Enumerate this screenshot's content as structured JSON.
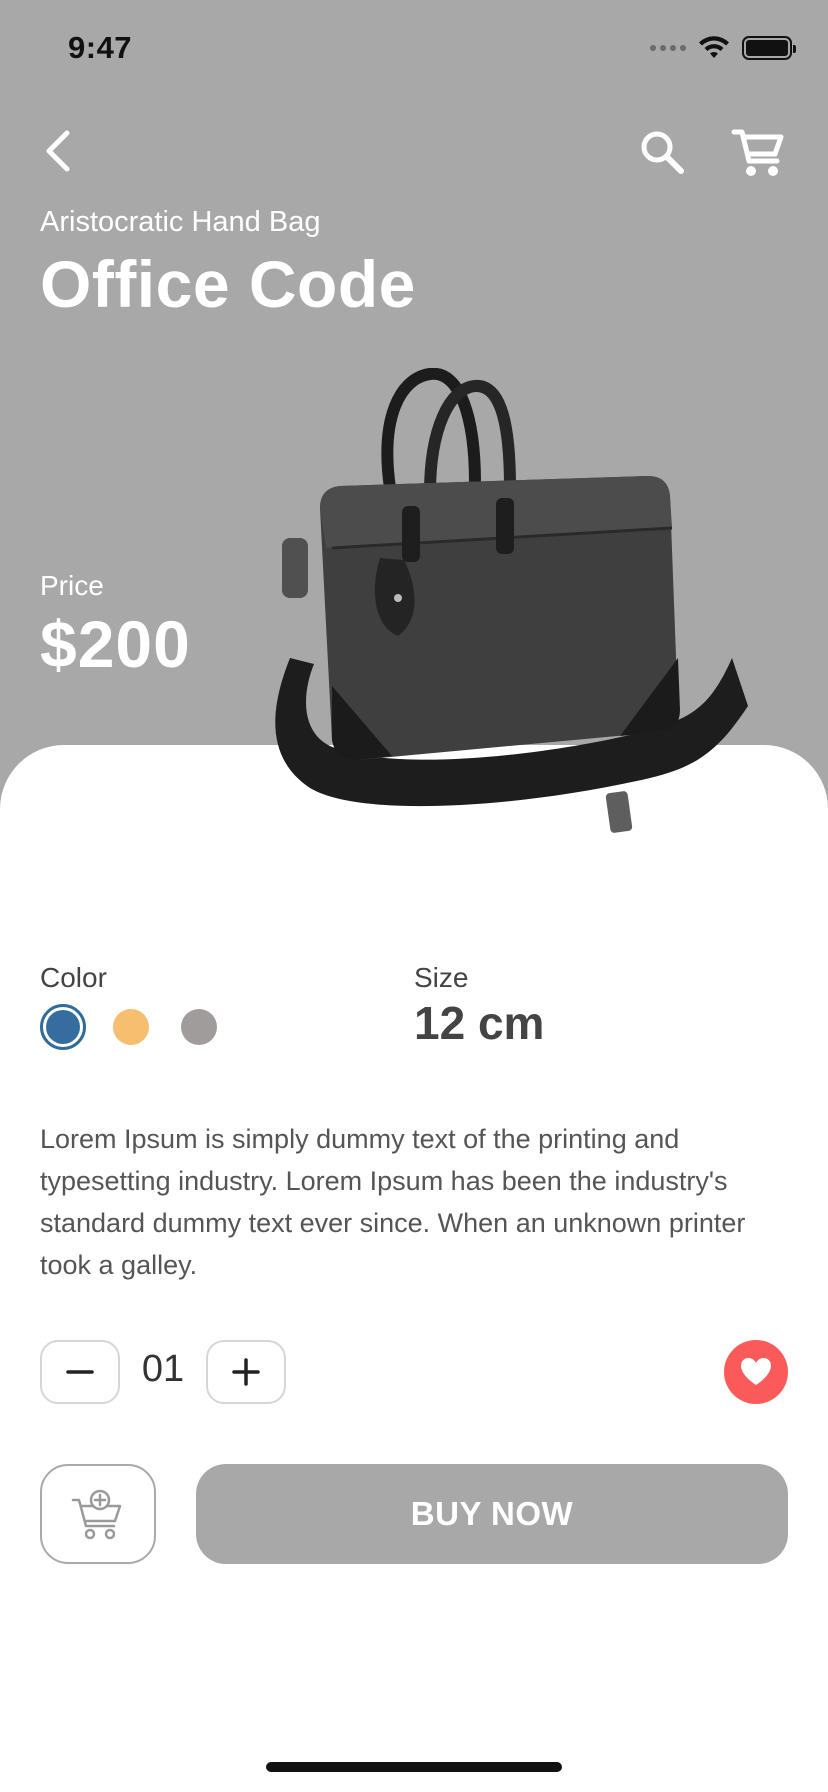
{
  "status_bar": {
    "time": "9:47"
  },
  "product": {
    "subtitle": "Aristocratic Hand Bag",
    "title": "Office Code",
    "price_label": "Price",
    "price": "$200"
  },
  "options": {
    "color_label": "Color",
    "colors": [
      "#356e9e",
      "#f6be6e",
      "#a19c9c"
    ],
    "selected_color_index": 0,
    "size_label": "Size",
    "size_value": "12 cm"
  },
  "description": "Lorem Ipsum is simply dummy text of the printing and typesetting industry. Lorem Ipsum has been the industry's standard dummy text ever since. When an unknown printer took a galley.",
  "quantity": {
    "value": "01"
  },
  "actions": {
    "buy_now_label": "BUY NOW"
  },
  "theme": {
    "hero_bg": "#a8a8a8",
    "favorite": "#fa5a5a"
  },
  "icons": [
    "back-icon",
    "search-icon",
    "cart-icon",
    "minus-icon",
    "plus-icon",
    "heart-icon",
    "add-to-cart-icon"
  ]
}
